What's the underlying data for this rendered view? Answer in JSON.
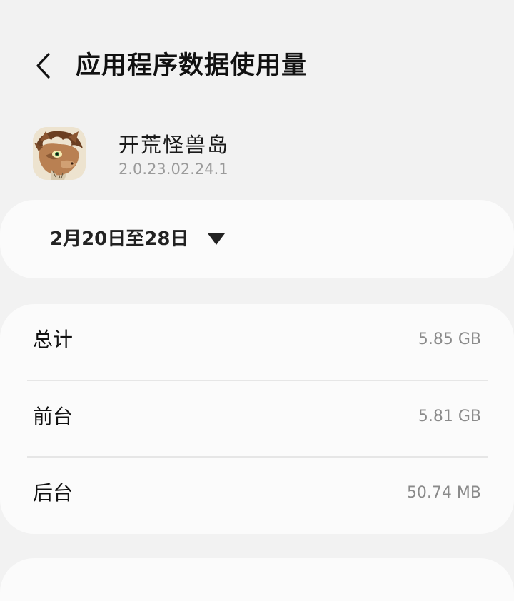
{
  "header": {
    "back_icon": "chevron-left-icon",
    "title": "应用程序数据使用量"
  },
  "app": {
    "icon": "monster-app-icon",
    "name": "开荒怪兽岛",
    "version": "2.0.23.02.24.1"
  },
  "date_range": {
    "label": "2月20日至28日",
    "dropdown_icon": "triangle-down-icon"
  },
  "usage": {
    "rows": [
      {
        "label": "总计",
        "value": "5.85 GB"
      },
      {
        "label": "前台",
        "value": "5.81 GB"
      },
      {
        "label": "后台",
        "value": "50.74 MB"
      }
    ]
  },
  "colors": {
    "background": "#f2f2f2",
    "card": "#fbfbfb",
    "secondary_text": "#8a8a8a"
  }
}
